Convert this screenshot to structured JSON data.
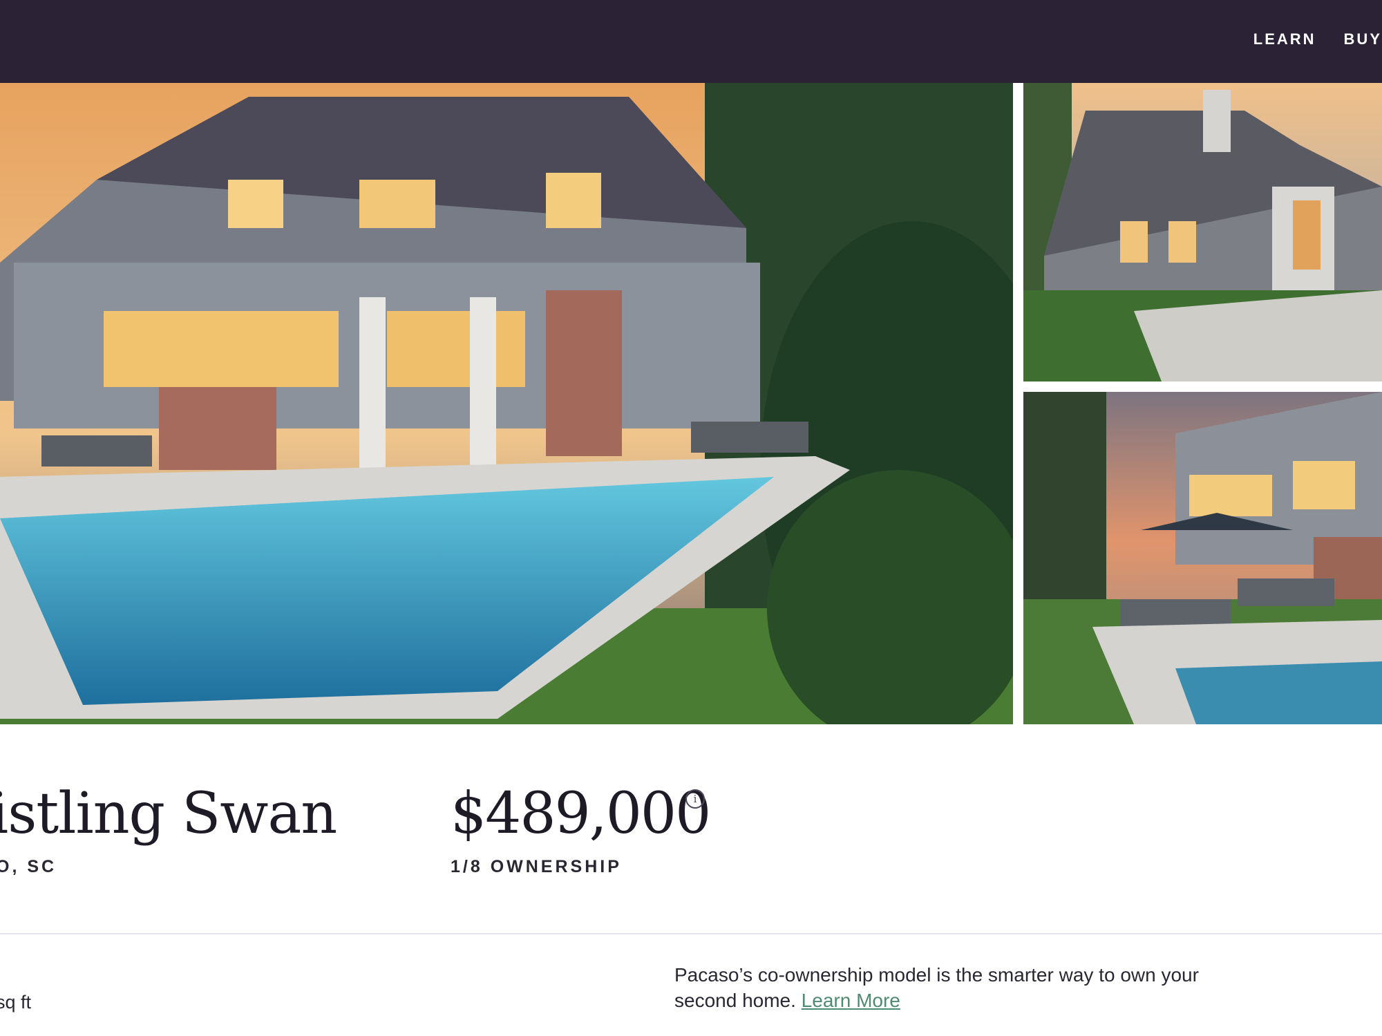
{
  "nav": {
    "items": [
      "LEARN",
      "BUY"
    ]
  },
  "listing": {
    "title": "istling Swan",
    "location": "O, SC",
    "price": "$489,000",
    "price_info_icon": "i",
    "ownership": "1/8 OWNERSHIP",
    "sqft_fragment": "sq ft"
  },
  "blurb": {
    "line1": "Pacaso’s co-ownership model is the smarter way to own your",
    "line2_prefix": "second home. ",
    "link_label": "Learn More"
  },
  "colors": {
    "header_bg": "#2b2236",
    "link_green": "#4f8a73",
    "text_dark": "#1e1b27"
  },
  "photos": {
    "main_alt": "",
    "side_top_alt": "",
    "side_bottom_alt": ""
  }
}
